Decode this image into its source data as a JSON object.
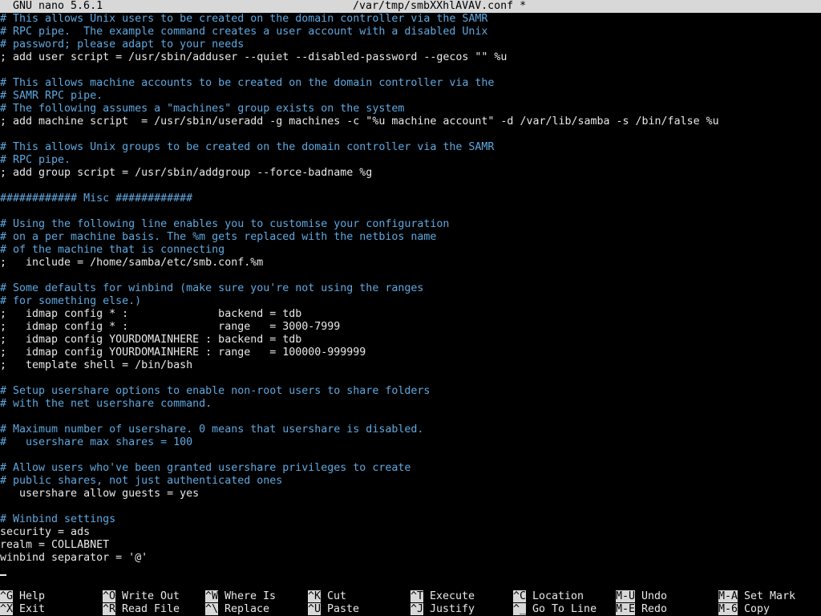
{
  "titlebar": {
    "app": "GNU nano 5.6.1",
    "filename": "/var/tmp/smbXXhlAVAV.conf *"
  },
  "editor": {
    "lines": [
      {
        "text": "# This allows Unix users to be created on the domain controller via the SAMR",
        "kind": "comment"
      },
      {
        "text": "# RPC pipe.  The example command creates a user account with a disabled Unix",
        "kind": "comment"
      },
      {
        "text": "# password; please adapt to your needs",
        "kind": "comment"
      },
      {
        "text": "; add user script = /usr/sbin/adduser --quiet --disabled-password --gecos \"\" %u",
        "kind": "code"
      },
      {
        "text": "",
        "kind": "code"
      },
      {
        "text": "# This allows machine accounts to be created on the domain controller via the",
        "kind": "comment"
      },
      {
        "text": "# SAMR RPC pipe.",
        "kind": "comment"
      },
      {
        "text": "# The following assumes a \"machines\" group exists on the system",
        "kind": "comment"
      },
      {
        "text": "; add machine script  = /usr/sbin/useradd -g machines -c \"%u machine account\" -d /var/lib/samba -s /bin/false %u",
        "kind": "code"
      },
      {
        "text": "",
        "kind": "code"
      },
      {
        "text": "# This allows Unix groups to be created on the domain controller via the SAMR",
        "kind": "comment"
      },
      {
        "text": "# RPC pipe.",
        "kind": "comment"
      },
      {
        "text": "; add group script = /usr/sbin/addgroup --force-badname %g",
        "kind": "code"
      },
      {
        "text": "",
        "kind": "code"
      },
      {
        "text": "############ Misc ############",
        "kind": "comment"
      },
      {
        "text": "",
        "kind": "code"
      },
      {
        "text": "# Using the following line enables you to customise your configuration",
        "kind": "comment"
      },
      {
        "text": "# on a per machine basis. The %m gets replaced with the netbios name",
        "kind": "comment"
      },
      {
        "text": "# of the machine that is connecting",
        "kind": "comment"
      },
      {
        "text": ";   include = /home/samba/etc/smb.conf.%m",
        "kind": "code"
      },
      {
        "text": "",
        "kind": "code"
      },
      {
        "text": "# Some defaults for winbind (make sure you're not using the ranges",
        "kind": "comment"
      },
      {
        "text": "# for something else.)",
        "kind": "comment"
      },
      {
        "text": ";   idmap config * :              backend = tdb",
        "kind": "code"
      },
      {
        "text": ";   idmap config * :              range   = 3000-7999",
        "kind": "code"
      },
      {
        "text": ";   idmap config YOURDOMAINHERE : backend = tdb",
        "kind": "code"
      },
      {
        "text": ";   idmap config YOURDOMAINHERE : range   = 100000-999999",
        "kind": "code"
      },
      {
        "text": ";   template shell = /bin/bash",
        "kind": "code"
      },
      {
        "text": "",
        "kind": "code"
      },
      {
        "text": "# Setup usershare options to enable non-root users to share folders",
        "kind": "comment"
      },
      {
        "text": "# with the net usershare command.",
        "kind": "comment"
      },
      {
        "text": "",
        "kind": "code"
      },
      {
        "text": "# Maximum number of usershare. 0 means that usershare is disabled.",
        "kind": "comment"
      },
      {
        "text": "#   usershare max shares = 100",
        "kind": "comment"
      },
      {
        "text": "",
        "kind": "code"
      },
      {
        "text": "# Allow users who've been granted usershare privileges to create",
        "kind": "comment"
      },
      {
        "text": "# public shares, not just authenticated ones",
        "kind": "comment"
      },
      {
        "text": "   usershare allow guests = yes",
        "kind": "code"
      },
      {
        "text": "",
        "kind": "code"
      },
      {
        "text": "# Winbind settings",
        "kind": "comment"
      },
      {
        "text": "security = ads",
        "kind": "code"
      },
      {
        "text": "realm = COLLABNET",
        "kind": "code"
      },
      {
        "text": "winbind separator = '@'",
        "kind": "code"
      }
    ]
  },
  "shortcuts": [
    {
      "key": "^G",
      "label": "Help",
      "name": "help"
    },
    {
      "key": "^X",
      "label": "Exit",
      "name": "exit"
    },
    {
      "key": "^O",
      "label": "Write Out",
      "name": "write-out"
    },
    {
      "key": "^R",
      "label": "Read File",
      "name": "read-file"
    },
    {
      "key": "^W",
      "label": "Where Is",
      "name": "where-is"
    },
    {
      "key": "^\\",
      "label": "Replace",
      "name": "replace"
    },
    {
      "key": "^K",
      "label": "Cut",
      "name": "cut"
    },
    {
      "key": "^U",
      "label": "Paste",
      "name": "paste"
    },
    {
      "key": "^T",
      "label": "Execute",
      "name": "execute"
    },
    {
      "key": "^J",
      "label": "Justify",
      "name": "justify"
    },
    {
      "key": "^C",
      "label": "Location",
      "name": "location"
    },
    {
      "key": "^_",
      "label": "Go To Line",
      "name": "go-to-line"
    },
    {
      "key": "M-U",
      "label": "Undo",
      "name": "undo"
    },
    {
      "key": "M-E",
      "label": "Redo",
      "name": "redo"
    },
    {
      "key": "M-A",
      "label": "Set Mark",
      "name": "set-mark"
    },
    {
      "key": "M-6",
      "label": "Copy",
      "name": "copy"
    }
  ],
  "colors": {
    "background": "#000000",
    "text": "#e8e8e8",
    "comment": "#5fa8e0",
    "bar": "#d8d8d8"
  }
}
